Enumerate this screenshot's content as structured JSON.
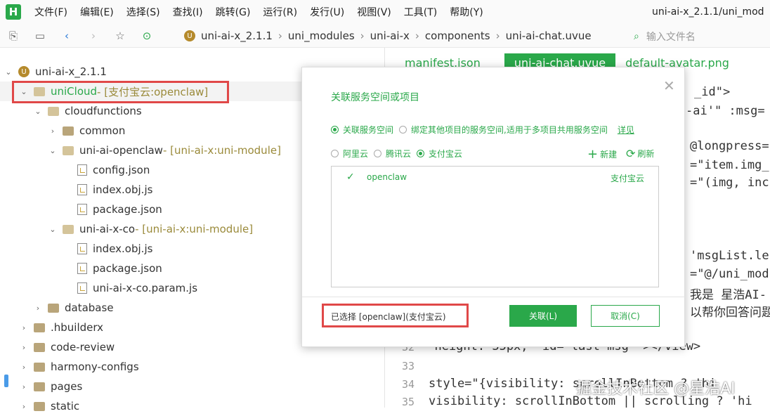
{
  "menubar": {
    "logo": "H",
    "items": [
      "文件(F)",
      "编辑(E)",
      "选择(S)",
      "查找(I)",
      "跳转(G)",
      "运行(R)",
      "发行(U)",
      "视图(V)",
      "工具(T)",
      "帮助(Y)"
    ],
    "window_title": "uni-ai-x_2.1.1/uni_mod"
  },
  "toolbar": {
    "breadcrumb": [
      "uni-ai-x_2.1.1",
      "uni_modules",
      "uni-ai-x",
      "components",
      "uni-ai-chat.uvue"
    ],
    "file_input_placeholder": "输入文件名"
  },
  "tree": {
    "rows": [
      {
        "label": "uni-ai-x_2.1.1",
        "suffix": ""
      },
      {
        "label": "uniCloud",
        "suffix": " - [支付宝云:openclaw]"
      },
      {
        "label": "cloudfunctions",
        "suffix": ""
      },
      {
        "label": "common",
        "suffix": ""
      },
      {
        "label": "uni-ai-openclaw",
        "suffix": " - [uni-ai-x:uni-module]"
      },
      {
        "label": "config.json",
        "suffix": ""
      },
      {
        "label": "index.obj.js",
        "suffix": ""
      },
      {
        "label": "package.json",
        "suffix": ""
      },
      {
        "label": "uni-ai-x-co",
        "suffix": " - [uni-ai-x:uni-module]"
      },
      {
        "label": "index.obj.js",
        "suffix": ""
      },
      {
        "label": "package.json",
        "suffix": ""
      },
      {
        "label": "uni-ai-x-co.param.js",
        "suffix": ""
      },
      {
        "label": "database",
        "suffix": ""
      },
      {
        "label": ".hbuilderx",
        "suffix": ""
      },
      {
        "label": "code-review",
        "suffix": ""
      },
      {
        "label": "harmony-configs",
        "suffix": ""
      },
      {
        "label": "pages",
        "suffix": ""
      },
      {
        "label": "static",
        "suffix": ""
      }
    ]
  },
  "editor": {
    "tabs": [
      "manifest.json",
      "uni-ai-chat.uvue",
      "default-avatar.png"
    ],
    "code": [
      "_id\">",
      "-ai'\" :msg=",
      "@longpress=",
      "=\"item.img_",
      "=\"(img, inc",
      "'msgList.ler",
      "=\"@/uni_modu",
      "我是 星浩AI-",
      "以帮你回答问题",
      "\" height: 35px;\" id=\"last-msg\" ></view>",
      "style=\"{visibility: scrollInBottom ? 'hi",
      "visibility: scrollInBottom || scrolling ? 'hi"
    ],
    "line_numbers": [
      "32",
      "33",
      "34",
      "35"
    ]
  },
  "modal": {
    "title": "关联服务空间或项目",
    "mode_options": [
      "关联服务空间",
      "绑定其他项目的服务空间,适用于多项目共用服务空间"
    ],
    "details_link": "详见",
    "providers": [
      "阿里云",
      "腾讯云",
      "支付宝云"
    ],
    "new_label": "新建",
    "refresh_label": "刷新",
    "space_name": "openclaw",
    "space_provider": "支付宝云",
    "selected_text": "已选择 [openclaw](支付宝云)",
    "ok_label": "关联(L)",
    "cancel_label": "取消(C)"
  },
  "watermark": "掘金技术社区 @星浩AI",
  "colors": {
    "accent": "#2aa84a",
    "highlight": "#e04848"
  }
}
